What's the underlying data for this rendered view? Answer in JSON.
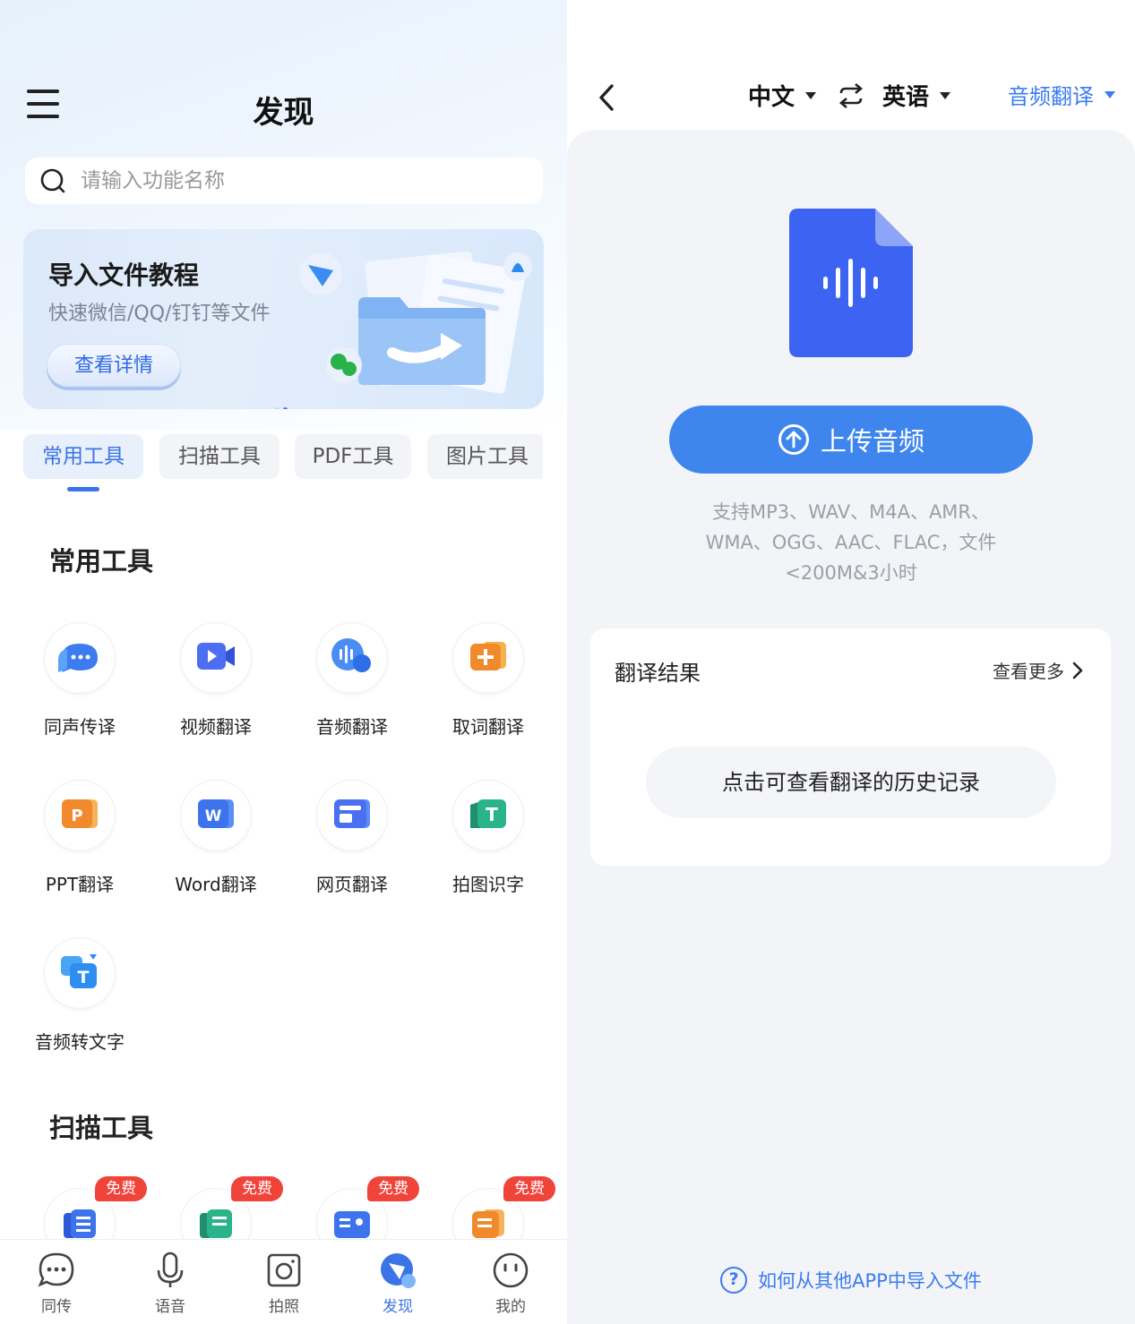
{
  "discover": {
    "title": "发现",
    "search": {
      "placeholder": "请输入功能名称"
    },
    "banner": {
      "title": "导入文件教程",
      "subtitle": "快速微信/QQ/钉钉等文件",
      "button": "查看详情"
    },
    "tabs": [
      "常用工具",
      "扫描工具",
      "PDF工具",
      "图片工具"
    ],
    "sections": {
      "common": {
        "title": "常用工具",
        "tools": [
          "同声传译",
          "视频翻译",
          "音频翻译",
          "取词翻译",
          "PPT翻译",
          "Word翻译",
          "网页翻译",
          "拍图识字",
          "音频转文字"
        ]
      },
      "scan": {
        "title": "扫描工具",
        "badge": "免费"
      }
    },
    "nav": [
      "同传",
      "语音",
      "拍照",
      "发现",
      "我的"
    ],
    "colors": {
      "accent": "#3b74e6",
      "badge": "#f0433a"
    }
  },
  "audio": {
    "source_lang": "中文",
    "target_lang": "英语",
    "mode": "音频翻译",
    "upload_button": "上传音频",
    "formats_line1": "支持MP3、WAV、M4A、AMR、",
    "formats_line2": "WMA、OGG、AAC、FLAC，文件",
    "formats_line3": "<200M&3小时",
    "result": {
      "title": "翻译结果",
      "more": "查看更多",
      "history": "点击可查看翻译的历史记录"
    },
    "help": "如何从其他APP中导入文件",
    "colors": {
      "primary": "#3e86ee",
      "file_icon": "#3d63f2"
    }
  }
}
